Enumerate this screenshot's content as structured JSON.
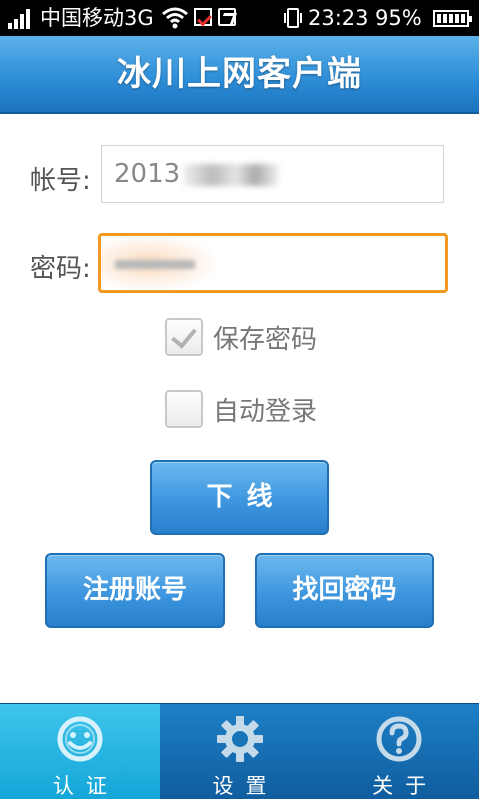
{
  "status_bar": {
    "carrier": "中国移动3G",
    "time": "23:23",
    "battery": "95%"
  },
  "header": {
    "title": "冰川上网客户端"
  },
  "form": {
    "username_label": "帐号:",
    "username_value": "2013",
    "password_label": "密码:",
    "save_password_label": "保存密码",
    "save_password_checked": true,
    "auto_login_label": "自动登录",
    "auto_login_checked": false
  },
  "buttons": {
    "logout": "下线",
    "register": "注册账号",
    "recover": "找回密码"
  },
  "tabs": [
    {
      "label": "认证",
      "icon": "smiley-icon",
      "active": true
    },
    {
      "label": "设置",
      "icon": "gear-icon",
      "active": false
    },
    {
      "label": "关于",
      "icon": "question-icon",
      "active": false
    }
  ],
  "colors": {
    "accent": "#2f8fd8",
    "focus_border": "#f29a1f",
    "tab_active": "#14a6d9"
  }
}
